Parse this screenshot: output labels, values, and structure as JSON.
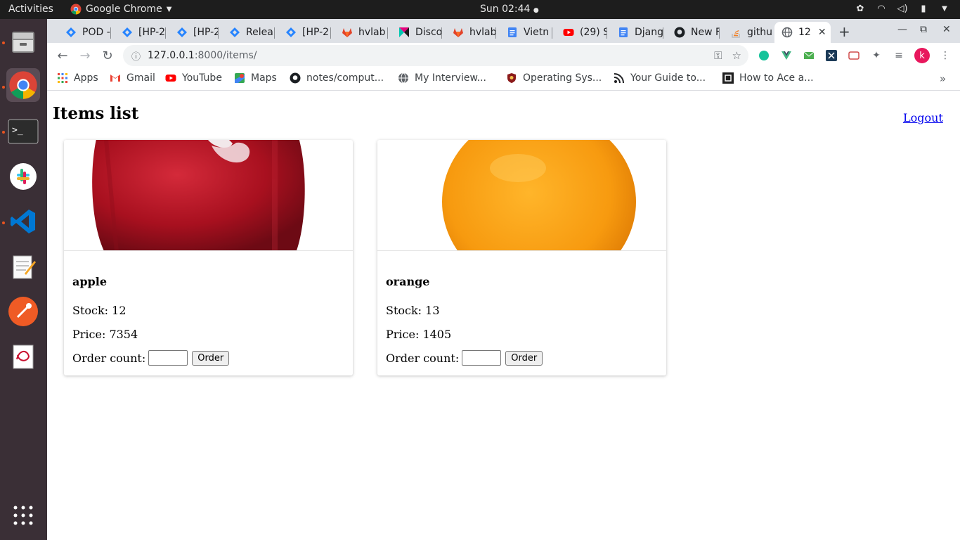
{
  "system_bar": {
    "activities": "Activities",
    "app_name": "Google Chrome",
    "clock": "Sun 02:44"
  },
  "tabs": [
    {
      "title": "POD -",
      "icon": "jira-icon"
    },
    {
      "title": "[HP-2",
      "icon": "jira-icon"
    },
    {
      "title": "[HP-2",
      "icon": "jira-icon"
    },
    {
      "title": "Relea",
      "icon": "jira-icon"
    },
    {
      "title": "[HP-2",
      "icon": "jira-icon"
    },
    {
      "title": "hvlab",
      "icon": "gitlab-icon"
    },
    {
      "title": "Disco",
      "icon": "kanban-icon"
    },
    {
      "title": "hvlab",
      "icon": "gitlab-icon"
    },
    {
      "title": "Vietn",
      "icon": "docs-icon"
    },
    {
      "title": "(29) S",
      "icon": "youtube-icon"
    },
    {
      "title": "Djang",
      "icon": "docs-icon"
    },
    {
      "title": "New F",
      "icon": "github-icon"
    },
    {
      "title": "githu",
      "icon": "stackoverflow-icon"
    },
    {
      "title": "12",
      "icon": "globe-icon",
      "active": true
    }
  ],
  "address_bar": {
    "host": "127.0.0.1",
    "path": ":8000/items/"
  },
  "bookmarks": [
    {
      "label": "Apps",
      "icon": "apps-grid-icon"
    },
    {
      "label": "Gmail",
      "icon": "gmail-icon"
    },
    {
      "label": "YouTube",
      "icon": "youtube-icon"
    },
    {
      "label": "Maps",
      "icon": "maps-icon"
    },
    {
      "label": "notes/comput...",
      "icon": "github-icon"
    },
    {
      "label": "My Interview...",
      "icon": "globe-icon"
    },
    {
      "label": "Operating Sys...",
      "icon": "shield-icon"
    },
    {
      "label": "Your Guide to...",
      "icon": "rss-icon"
    },
    {
      "label": "How to Ace a...",
      "icon": "square-logo-icon"
    }
  ],
  "page": {
    "heading": "Items list",
    "logout": "Logout",
    "order_button": "Order",
    "items": [
      {
        "name": "apple",
        "stock": "Stock: 12",
        "price": "Price: 7354",
        "order_label": "Order count:",
        "order_value": ""
      },
      {
        "name": "orange",
        "stock": "Stock: 13",
        "price": "Price: 1405",
        "order_label": "Order count:",
        "order_value": ""
      }
    ]
  },
  "colors": {
    "accent_orange": "#e95420",
    "profile_avatar": "#e8175d",
    "link": "#0000ee"
  },
  "profile_initial": "k"
}
